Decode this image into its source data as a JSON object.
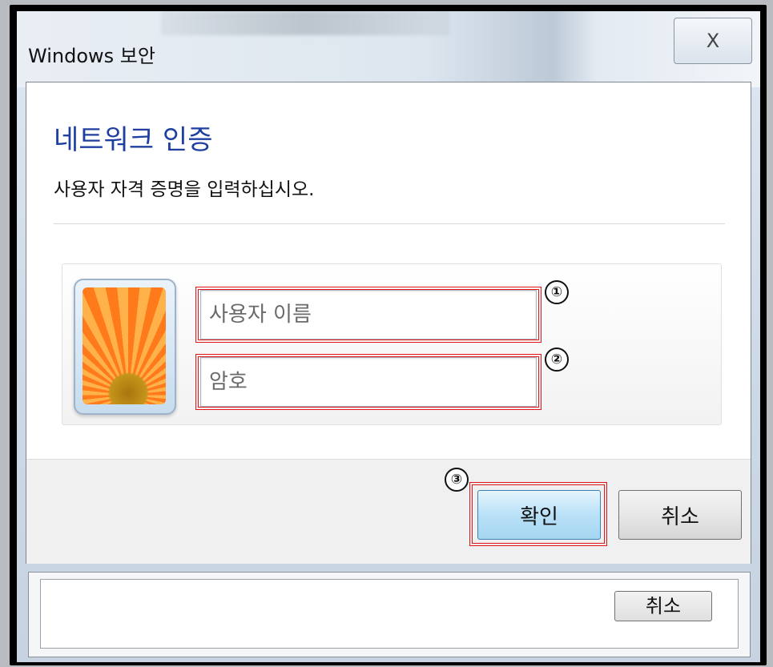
{
  "window": {
    "title": "Windows 보안",
    "close_label": "X"
  },
  "dialog": {
    "heading": "네트워크 인증",
    "subheading": "사용자 자격 증명을 입력하십시오.",
    "username_placeholder": "사용자 이름",
    "password_placeholder": "암호",
    "ok_label": "확인",
    "cancel_label": "취소"
  },
  "annotations": {
    "marker_1": "①",
    "marker_2": "②",
    "marker_3": "③",
    "highlight_color": "#e01515"
  },
  "background_window": {
    "cancel_label": "취소"
  }
}
